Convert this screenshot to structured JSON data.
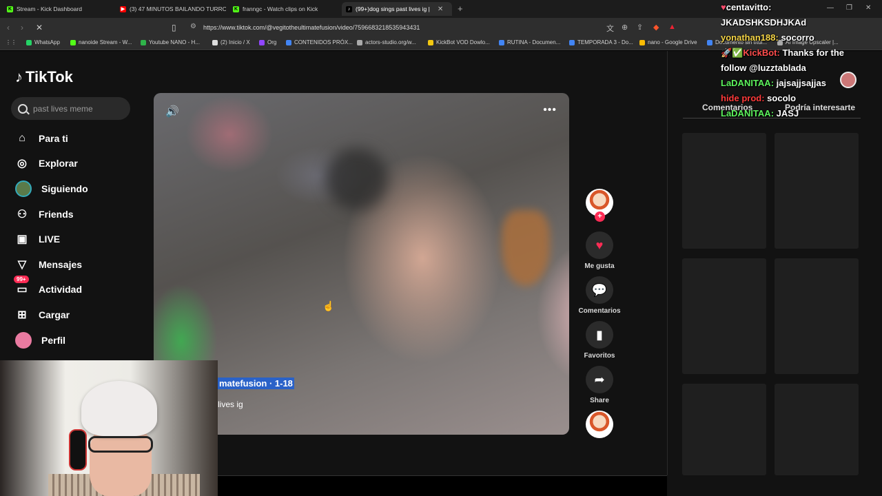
{
  "browser": {
    "tabs": [
      {
        "label": "Stream - Kick Dashboard",
        "fav_color": "#53fc18",
        "fav_char": "K",
        "active": false
      },
      {
        "label": "(3) 47 MINUTOS BAILANDO TURRO",
        "fav_color": "#ff0000",
        "fav_char": "▶",
        "active": false
      },
      {
        "label": "franngc - Watch clips on Kick",
        "fav_color": "#53fc18",
        "fav_char": "K",
        "active": false
      },
      {
        "label": "(99+)dog sings past lives ig |",
        "fav_color": "#ffffff",
        "fav_char": "♪",
        "active": true
      }
    ],
    "new_tab_label": "+",
    "url": "https://www.tiktok.com/@vegitotheultimatefusion/video/7596683218535943431",
    "bookmarks": [
      {
        "label": "WhatsApp",
        "fav_color": "#25d366"
      },
      {
        "label": "nanoide Stream - W...",
        "fav_color": "#53fc18"
      },
      {
        "label": "Youtube NANO - H...",
        "fav_color": "#2fb34a"
      },
      {
        "label": "(2) Inicio / X",
        "fav_color": "#dddddd"
      },
      {
        "label": "Org",
        "fav_color": "#9146ff"
      },
      {
        "label": "CONTENIDOS PRÓX...",
        "fav_color": "#4285f4"
      },
      {
        "label": "actors-studio.org/w...",
        "fav_color": "#aaaaaa"
      },
      {
        "label": "KickBot VOD Dowlo...",
        "fav_color": "#f2c811"
      },
      {
        "label": "RUTINA - Documen...",
        "fav_color": "#4285f4"
      },
      {
        "label": "TEMPORADA 3 - Do...",
        "fav_color": "#4285f4"
      },
      {
        "label": "nano - Google Drive",
        "fav_color": "#fbbc04"
      },
      {
        "label": "Documento sin títul...",
        "fav_color": "#4285f4"
      },
      {
        "label": "AI Image Upscaler |...",
        "fav_color": "#aaaaaa"
      }
    ]
  },
  "tiktok": {
    "logo": "TikTok",
    "search_placeholder": "past lives meme",
    "sidebar": [
      {
        "label": "Para ti",
        "icon": "home-icon",
        "glyph": "⌂"
      },
      {
        "label": "Explorar",
        "icon": "compass-icon",
        "glyph": "◎"
      },
      {
        "label": "Siguiendo",
        "icon": "avatar",
        "glyph": ""
      },
      {
        "label": "Friends",
        "icon": "friends-icon",
        "glyph": "👥"
      },
      {
        "label": "LIVE",
        "icon": "live-icon",
        "glyph": "▣"
      },
      {
        "label": "Mensajes",
        "icon": "send-icon",
        "glyph": "▽"
      },
      {
        "label": "Actividad",
        "icon": "activity-icon",
        "glyph": "▭",
        "badge": "99+"
      },
      {
        "label": "Cargar",
        "icon": "upload-icon",
        "glyph": "⊞"
      },
      {
        "label": "Perfil",
        "icon": "profile-avatar",
        "glyph": ""
      }
    ],
    "video": {
      "author_line": "matefusion · 1-18",
      "description": "lives ig"
    },
    "actions": {
      "like_label": "Me gusta",
      "comments_label": "Comentarios",
      "favorites_label": "Favoritos",
      "share_label": "Share"
    },
    "right_panel": {
      "tab_comments": "Comentarios",
      "tab_related": "Podría interesarte"
    }
  },
  "chat": [
    {
      "user": "centavitto:",
      "color": "#ffffff",
      "msg": ""
    },
    {
      "user": "",
      "color": "#ffffff",
      "msg": "JKADSHKSDHJKAd"
    },
    {
      "user": "yonathan188:",
      "color": "#f5d547",
      "msg": "socorro"
    },
    {
      "user": "KickBot:",
      "color": "#ff4d4d",
      "msg": "Thanks for the"
    },
    {
      "user": "",
      "color": "#ffffff",
      "msg": "follow @luzztablada"
    },
    {
      "user": "LaDANITAA:",
      "color": "#5cf25c",
      "msg": "jajsajjsajjas"
    },
    {
      "user": "hide prod:",
      "color": "#ff3b3b",
      "msg": "socolo"
    },
    {
      "user": "LaDANITAA:",
      "color": "#5cf25c",
      "msg": "JASJ"
    }
  ]
}
